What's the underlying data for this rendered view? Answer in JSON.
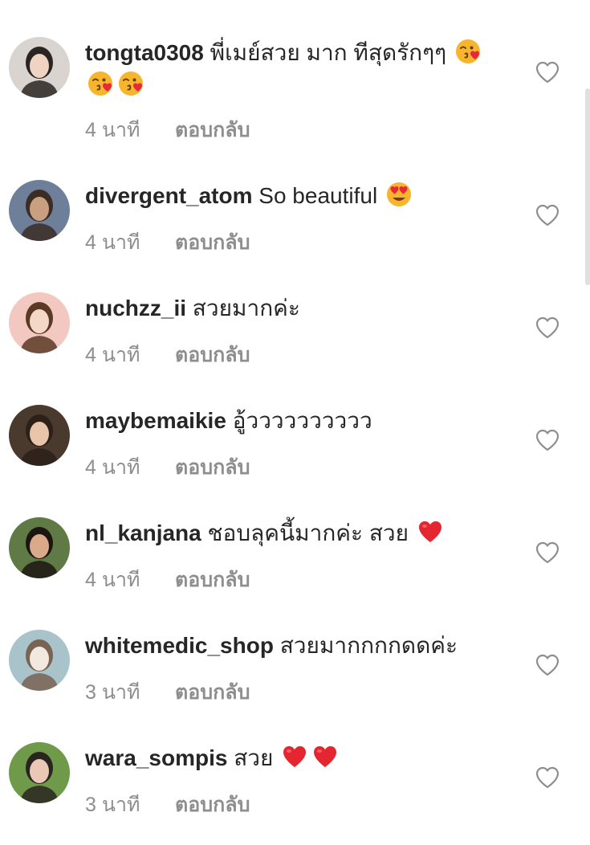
{
  "comments": [
    {
      "username": "tongta0308",
      "text": "พี่เมย์สวย มาก ทีสุดรักๆๆ",
      "emojis": [
        "kissing-heart",
        "kissing-heart",
        "kissing-heart"
      ],
      "time": "4 นาที",
      "reply": "ตอบกลับ",
      "avatar": {
        "bg": "#d9d4d0",
        "skin": "#f0d3c2",
        "hair": "#2a2522"
      }
    },
    {
      "username": "divergent_atom",
      "text": "So beautiful",
      "emojis": [
        "heart-eyes"
      ],
      "time": "4 นาที",
      "reply": "ตอบกลับ",
      "avatar": {
        "bg": "#6e7f99",
        "skin": "#c99f82",
        "hair": "#3b2d24"
      }
    },
    {
      "username": "nuchzz_ii",
      "text": "สวยมากค่ะ",
      "emojis": [],
      "time": "4 นาที",
      "reply": "ตอบกลับ",
      "avatar": {
        "bg": "#f3c8c0",
        "skin": "#f3d8c8",
        "hair": "#5a3a25"
      }
    },
    {
      "username": "maybemaikie",
      "text": "อู้วววววววววว",
      "emojis": [],
      "time": "4 นาที",
      "reply": "ตอบกลับ",
      "avatar": {
        "bg": "#4a3a2e",
        "skin": "#e8c4a8",
        "hair": "#2c2018"
      }
    },
    {
      "username": "nl_kanjana",
      "text": "ชอบลุคนี้มากค่ะ สวย",
      "emojis": [
        "red-heart"
      ],
      "time": "4 นาที",
      "reply": "ตอบกลับ",
      "avatar": {
        "bg": "#5f7a44",
        "skin": "#d9a98a",
        "hair": "#1c1612"
      }
    },
    {
      "username": "whitemedic_shop",
      "text": "สวยมากกกกดดค่ะ",
      "emojis": [],
      "time": "3 นาที",
      "reply": "ตอบกลับ",
      "avatar": {
        "bg": "#a8c3c9",
        "skin": "#f1e9df",
        "hair": "#7a6352"
      }
    },
    {
      "username": "wara_sompis",
      "text": "สวย",
      "emojis": [
        "red-heart",
        "red-heart"
      ],
      "time": "3 นาที",
      "reply": "ตอบกลับ",
      "avatar": {
        "bg": "#6f9a4a",
        "skin": "#e9c8b6",
        "hair": "#2a2420"
      }
    }
  ]
}
